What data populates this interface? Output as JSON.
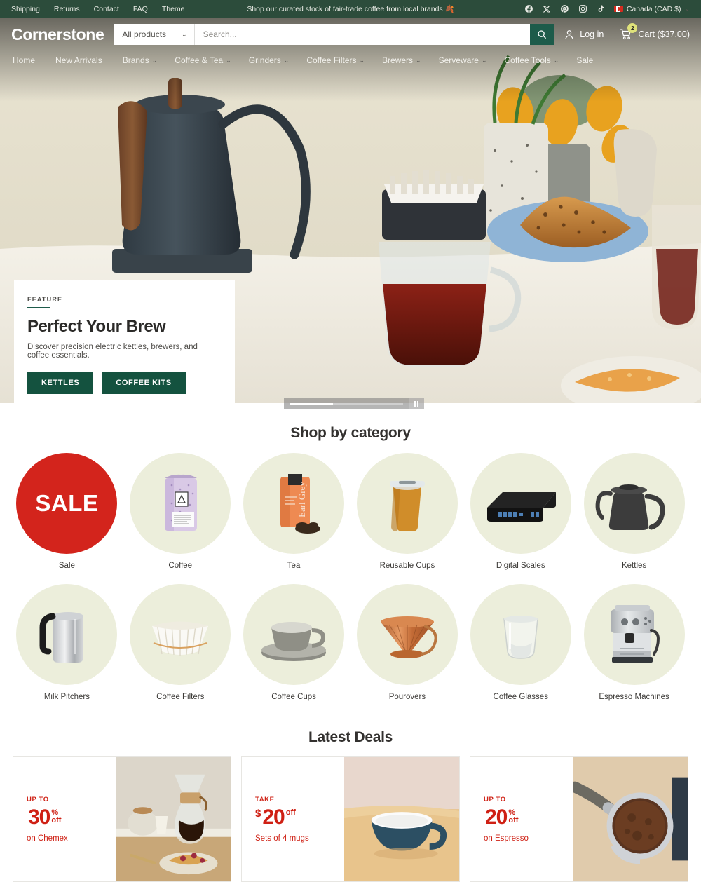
{
  "topbar": {
    "links": [
      "Shipping",
      "Returns",
      "Contact",
      "FAQ",
      "Theme"
    ],
    "promo": "Shop our curated stock of fair-trade coffee from local brands 🍂",
    "social": [
      "facebook-icon",
      "x-icon",
      "pinterest-icon",
      "instagram-icon",
      "tiktok-icon"
    ],
    "currency": "Canada (CAD $)",
    "currency_chevron": "⌄"
  },
  "header": {
    "logo": "Cornerstone",
    "search_category": "All products",
    "search_placeholder": "Search...",
    "search_value": "",
    "search_chevron": "⌄",
    "login_label": "Log in",
    "cart_label": "Cart ($37.00)",
    "cart_count": "2"
  },
  "nav": {
    "items": [
      {
        "label": "Home",
        "caret": ""
      },
      {
        "label": "New Arrivals",
        "caret": ""
      },
      {
        "label": "Brands",
        "caret": "⌄"
      },
      {
        "label": "Coffee & Tea",
        "caret": "⌄"
      },
      {
        "label": "Grinders",
        "caret": "⌄"
      },
      {
        "label": "Coffee Filters",
        "caret": "⌄"
      },
      {
        "label": "Brewers",
        "caret": "⌄"
      },
      {
        "label": "Serveware",
        "caret": "⌄"
      },
      {
        "label": "Coffee Tools",
        "caret": "⌄"
      },
      {
        "label": "Sale",
        "caret": ""
      }
    ]
  },
  "hero": {
    "kicker": "FEATURE",
    "title": "Perfect Your Brew",
    "subtitle": "Discover precision electric kettles, brewers, and coffee essentials.",
    "button_primary": "KETTLES",
    "button_secondary": "COFFEE KITS",
    "carousel_progress": "38",
    "pause_icon": "pause-icon"
  },
  "categories": {
    "title": "Shop by category",
    "items": [
      {
        "label": "Sale",
        "art": "sale"
      },
      {
        "label": "Coffee",
        "art": "coffee-bag"
      },
      {
        "label": "Tea",
        "art": "tea-pouch"
      },
      {
        "label": "Reusable Cups",
        "art": "tumbler"
      },
      {
        "label": "Digital Scales",
        "art": "scale"
      },
      {
        "label": "Kettles",
        "art": "kettle"
      },
      {
        "label": "Milk Pitchers",
        "art": "pitcher"
      },
      {
        "label": "Coffee Filters",
        "art": "filter"
      },
      {
        "label": "Coffee Cups",
        "art": "cup-saucer"
      },
      {
        "label": "Pourovers",
        "art": "pourover"
      },
      {
        "label": "Coffee Glasses",
        "art": "glass"
      },
      {
        "label": "Espresso Machines",
        "art": "espresso-machine"
      }
    ]
  },
  "deals": {
    "title": "Latest Deals",
    "items": [
      {
        "kicker": "UP TO",
        "currency": "",
        "amount": "30",
        "unit": "%",
        "off": "off",
        "desc": "on Chemex",
        "art": "chemex-photo"
      },
      {
        "kicker": "TAKE",
        "currency": "$",
        "amount": "20",
        "unit": "",
        "off": "off",
        "desc": "Sets of 4 mugs",
        "art": "mug-photo"
      },
      {
        "kicker": "UP TO",
        "currency": "",
        "amount": "20",
        "unit": "%",
        "off": "off",
        "desc": "on Espresso",
        "art": "portafilter-photo"
      }
    ]
  },
  "colors": {
    "brand_green": "#2c4c3b",
    "button_green": "#14523f",
    "sale_red": "#d3241c",
    "deal_red": "#cf2014",
    "category_circle": "#eceedb",
    "cart_badge": "#dfe27a"
  }
}
